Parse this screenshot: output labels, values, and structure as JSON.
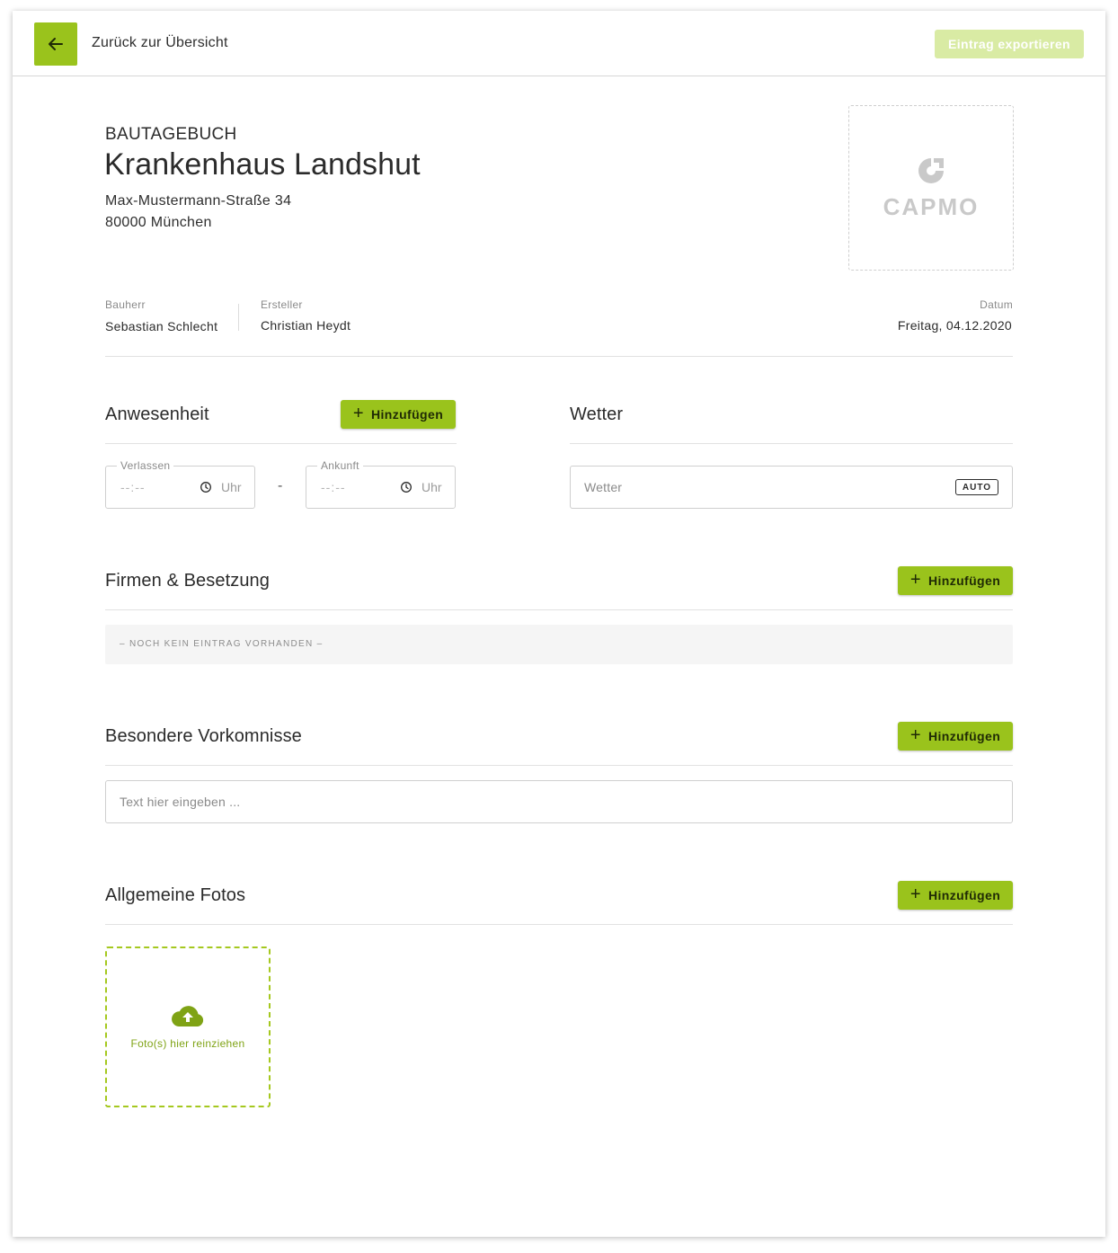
{
  "topbar": {
    "back_label": "Zurück zur Übersicht",
    "export_label": "Eintrag exportieren"
  },
  "header": {
    "doc_type": "BAUTAGEBUCH",
    "title": "Krankenhaus Landshut",
    "street": "Max-Mustermann-Straße 34",
    "city": "80000 München",
    "logo_text": "CAPMO"
  },
  "meta": {
    "bauherr_label": "Bauherr",
    "bauherr_value": "Sebastian Schlecht",
    "ersteller_label": "Ersteller",
    "ersteller_value": "Christian Heydt",
    "datum_label": "Datum",
    "datum_value": "Freitag, 04.12.2020"
  },
  "anwesenheit": {
    "title": "Anwesenheit",
    "add_label": "Hinzufügen",
    "verlassen_label": "Verlassen",
    "ankunft_label": "Ankunft",
    "time_placeholder": "--:--",
    "time_unit": "Uhr",
    "separator": "-"
  },
  "wetter": {
    "title": "Wetter",
    "placeholder": "Wetter",
    "badge": "AUTO"
  },
  "firmen": {
    "title": "Firmen & Besetzung",
    "add_label": "Hinzufügen",
    "empty_text": "– NOCH KEIN EINTRAG VORHANDEN –"
  },
  "vorkommnisse": {
    "title": "Besondere Vorkomnisse",
    "add_label": "Hinzufügen",
    "placeholder": "Text hier eingeben ..."
  },
  "fotos": {
    "title": "Allgemeine Fotos",
    "add_label": "Hinzufügen",
    "drop_text": "Foto(s) hier reinziehen"
  },
  "colors": {
    "accent": "#9ac31c",
    "accent_disabled": "#d9eba4",
    "text": "#2b2b2b"
  }
}
